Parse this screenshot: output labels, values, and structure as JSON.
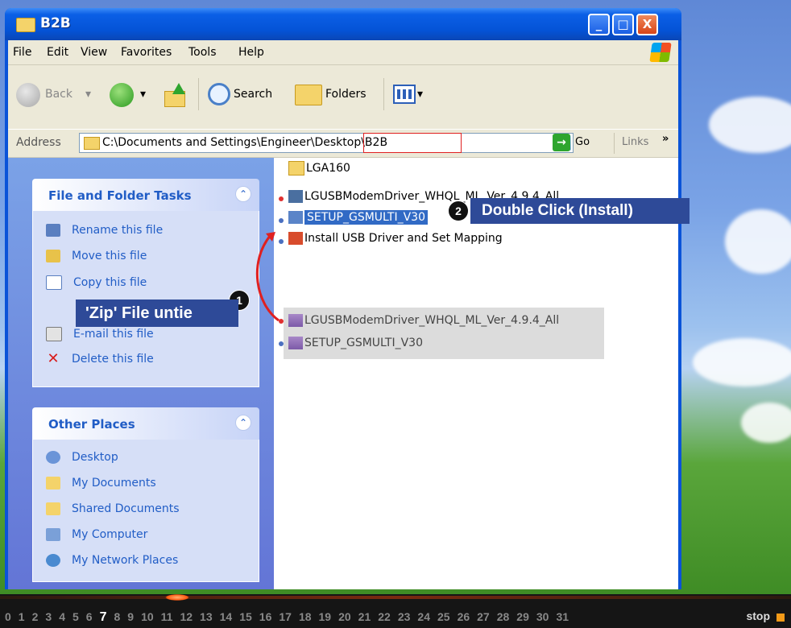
{
  "window": {
    "title": "B2B",
    "buttons": {
      "minimize": "_",
      "maximize": "□",
      "close": "X"
    }
  },
  "menu": [
    "File",
    "Edit",
    "View",
    "Favorites",
    "Tools",
    "Help"
  ],
  "toolbar": {
    "back": "Back",
    "search": "Search",
    "folders": "Folders"
  },
  "address": {
    "label": "Address",
    "path": "C:\\Documents and Settings\\Engineer\\Desktop\\B2B",
    "go": "Go",
    "links": "Links"
  },
  "file_tasks": {
    "title": "File and Folder Tasks",
    "items": [
      "Rename this file",
      "Move this file",
      "Copy this file",
      "E-mail this file",
      "Delete this file"
    ]
  },
  "other_places": {
    "title": "Other Places",
    "items": [
      "Desktop",
      "My Documents",
      "Shared Documents",
      "My Computer",
      "My Network Places"
    ]
  },
  "files": [
    {
      "name": "LGA160",
      "type": "folder"
    },
    {
      "name": "LGUSBModemDriver_WHQL_ML_Ver_4.9.4_All",
      "type": "installer"
    },
    {
      "name": "SETUP_GSMULTI_V30",
      "type": "setup",
      "selected": true
    },
    {
      "name": "Install USB Driver and Set Mapping",
      "type": "batch"
    }
  ],
  "zip_files": [
    {
      "name": "LGUSBModemDriver_WHQL_ML_Ver_4.9.4_All",
      "type": "zip"
    },
    {
      "name": "SETUP_GSMULTI_V30",
      "type": "zip"
    }
  ],
  "callouts": {
    "step1": {
      "badge": "1",
      "text": "'Zip' File untie"
    },
    "step2": {
      "badge": "2",
      "text": "Double Click (Install)"
    }
  },
  "timeline": {
    "numbers": [
      "0",
      "1",
      "2",
      "3",
      "4",
      "5",
      "6",
      "7",
      "8",
      "9",
      "10",
      "11",
      "12",
      "13",
      "14",
      "15",
      "16",
      "17",
      "18",
      "19",
      "20",
      "21",
      "22",
      "23",
      "24",
      "25",
      "26",
      "27",
      "28",
      "29",
      "30",
      "31"
    ],
    "active": 7,
    "stop": "stop"
  },
  "colors": {
    "title_blue": "#0453d6",
    "task_link": "#215dc6",
    "selection": "#316ac5",
    "callout": "#2e4a98",
    "highlight_red": "#e02020",
    "timeline_accent": "#f39a18"
  }
}
